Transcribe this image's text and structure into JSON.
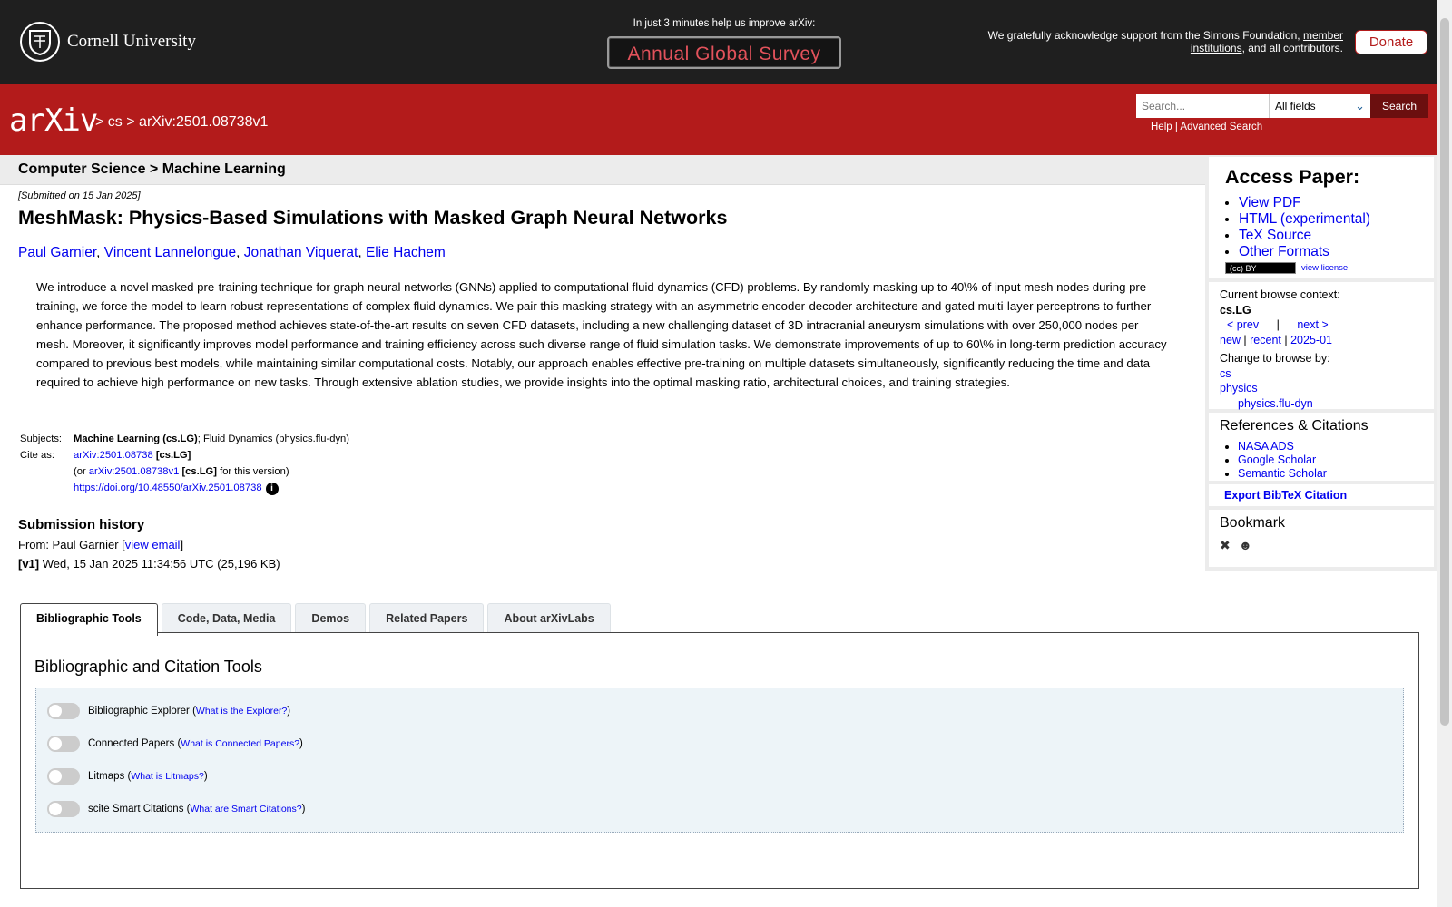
{
  "top_banner": {
    "institution": "Cornell University",
    "survey_prompt": "In just 3 minutes help us improve arXiv:",
    "survey_button": "Annual Global Survey",
    "support_prefix": "We gratefully acknowledge support from the Simons Foundation,",
    "support_link": "member institutions",
    "support_suffix": ", and all contributors.",
    "donate_label": "Donate"
  },
  "header": {
    "logo_text": "arXiv",
    "breadcrumb_sep1": ">",
    "breadcrumb_cs": "cs",
    "breadcrumb_sep2": ">",
    "breadcrumb_id": "arXiv:2501.08738v1",
    "search_placeholder": "Search...",
    "search_field": "All fields",
    "search_button": "Search",
    "help_link": "Help",
    "help_sep": "|",
    "advanced_link": "Advanced Search"
  },
  "subheader": {
    "title": "Computer Science > Machine Learning"
  },
  "article": {
    "dateline": "[Submitted on 15 Jan 2025]",
    "title": "MeshMask: Physics-Based Simulations with Masked Graph Neural Networks",
    "authors": [
      "Paul Garnier",
      "Vincent Lannelongue",
      "Jonathan Viquerat",
      "Elie Hachem"
    ],
    "abstract": "We introduce a novel masked pre-training technique for graph neural networks (GNNs) applied to computational fluid dynamics (CFD) problems. By randomly masking up to 40\\% of input mesh nodes during pre-training, we force the model to learn robust representations of complex fluid dynamics. We pair this masking strategy with an asymmetric encoder-decoder architecture and gated multi-layer perceptrons to further enhance performance. The proposed method achieves state-of-the-art results on seven CFD datasets, including a new challenging dataset of 3D intracranial aneurysm simulations with over 250,000 nodes per mesh. Moreover, it significantly improves model performance and training efficiency across such diverse range of fluid simulation tasks. We demonstrate improvements of up to 60\\% in long-term prediction accuracy compared to previous best models, while maintaining similar computational costs. Notably, our approach enables effective pre-training on multiple datasets simultaneously, significantly reducing the time and data required to achieve high performance on new tasks. Through extensive ablation studies, we provide insights into the optimal masking ratio, architectural choices, and training strategies.",
    "subjects_label": "Subjects:",
    "subjects_primary": "Machine Learning (cs.LG)",
    "subjects_rest": "; Fluid Dynamics (physics.flu-dyn)",
    "cite_label": "Cite as:",
    "cite_id": "arXiv:2501.08738",
    "cite_tag": "[cs.LG]",
    "cite_alt_open": "(or",
    "cite_alt_id": "arXiv:2501.08738v1",
    "cite_alt_tag": "[cs.LG]",
    "cite_alt_close": "for this version)",
    "doi": "https://doi.org/10.48550/arXiv.2501.08738",
    "history_title": "Submission history",
    "history_from": "From: Paul Garnier [",
    "history_email": "view email",
    "history_close": "]",
    "history_version": "[v1]",
    "history_detail": "Wed, 15 Jan 2025 11:34:56 UTC (25,196 KB)"
  },
  "sidebar": {
    "access_title": "Access Paper:",
    "access_links": [
      "View PDF",
      "HTML (experimental)",
      "TeX Source",
      "Other Formats"
    ],
    "license_link": "view license",
    "context_label": "Current browse context:",
    "context_value": "cs.LG",
    "prev": "< prev",
    "pipe": "|",
    "next": "next >",
    "new": "new",
    "recent": "recent",
    "month": "2025-01",
    "change_label": "Change to browse by:",
    "browse_cs": "cs",
    "browse_physics": "physics",
    "browse_flu": "physics.flu-dyn",
    "refs_title": "References & Citations",
    "refs": [
      "NASA ADS",
      "Google Scholar",
      "Semantic Scholar"
    ],
    "bibtex": "Export BibTeX Citation",
    "bookmark_title": "Bookmark"
  },
  "tabs": [
    "Bibliographic Tools",
    "Code, Data, Media",
    "Demos",
    "Related Papers",
    "About arXivLabs"
  ],
  "panel": {
    "title": "Bibliographic and Citation Tools",
    "tools": [
      {
        "label": "Bibliographic Explorer",
        "link": "What is the Explorer?"
      },
      {
        "label": "Connected Papers",
        "link": "What is Connected Papers?"
      },
      {
        "label": "Litmaps",
        "link": "What is Litmaps?"
      },
      {
        "label": "scite Smart Citations",
        "link": "What are Smart Citations?"
      }
    ]
  },
  "colors": {
    "arxiv_red": "#b31b1b",
    "link_blue": "#0000ee",
    "topbar": "#1f1f1f"
  }
}
